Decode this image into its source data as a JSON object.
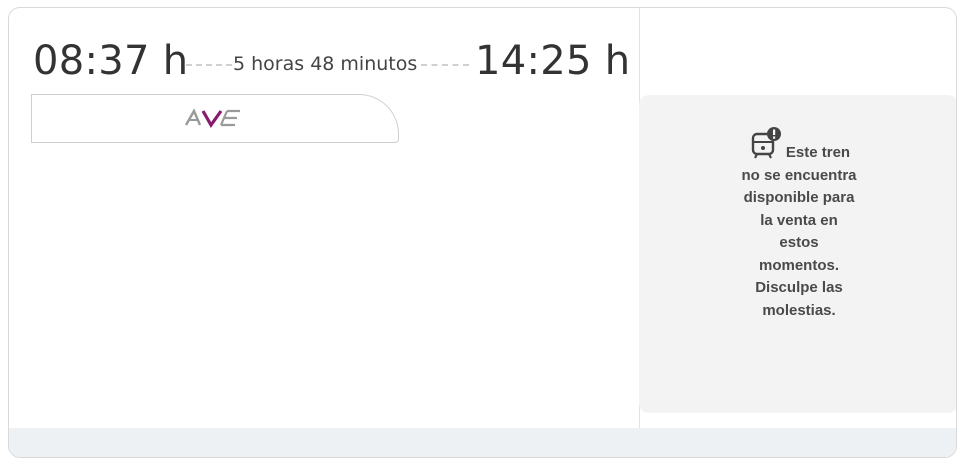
{
  "trip": {
    "departure": "08:37 h",
    "duration": "5 horas 48 minutos",
    "arrival": "14:25 h"
  },
  "brand": {
    "logo_text": "AVE",
    "icon": "ave-logo-icon",
    "accent_color": "#8a1a6d"
  },
  "availability": {
    "icon": "train-unavailable-icon",
    "message": "Este tren no se encuentra disponible para la venta en estos momentos. Disculpe las molestias."
  },
  "colors": {
    "border": "#d9d9d9",
    "notice_bg": "#f3f3f3",
    "footer_bg": "#eef1f4"
  }
}
